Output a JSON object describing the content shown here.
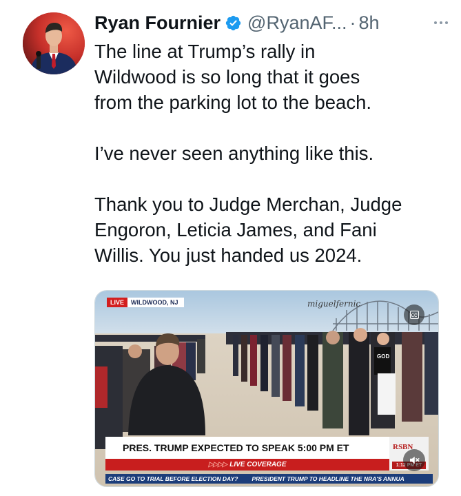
{
  "author": {
    "display_name": "Ryan Fournier",
    "handle": "@RyanAF...",
    "separator": "·",
    "time": "8h"
  },
  "tweet": {
    "paragraphs": [
      "The line at Trump’s rally in\nWildwood is so long that it goes\nfrom the parking lot to the beach.",
      "I’ve never seen anything like this.",
      "Thank you to Judge Merchan, Judge\nEngoron, Leticia James, and Fani\nWillis. You just handed us 2024."
    ]
  },
  "media": {
    "live_label": "LIVE",
    "location_label": "WILDWOOD, NJ",
    "watermark": "miguelfernic",
    "cc_label": "cc",
    "headline": "PRES. TRUMP EXPECTED TO SPEAK 5:00 PM ET",
    "live_coverage_arrows": "▷▷▷▷",
    "live_coverage": "LIVE COVERAGE",
    "network_logo": "RSBN",
    "clock": "1:12 PM ET",
    "ticker_left": "CASE GO TO TRIAL BEFORE ELECTION DAY?",
    "ticker_right": "PRESIDENT TRUMP TO HEADLINE THE NRA'S ANNUA",
    "crowd_shirt_text": "GOD"
  },
  "colors": {
    "verified_blue": "#1d9bf0",
    "secondary_text": "#536471",
    "live_red": "#d31f1f",
    "ticker_blue": "#1c3d7a"
  },
  "icons": {
    "verified": "verified-badge-icon",
    "more": "more-options-icon",
    "mute": "mute-icon",
    "captions": "closed-captions-icon"
  }
}
